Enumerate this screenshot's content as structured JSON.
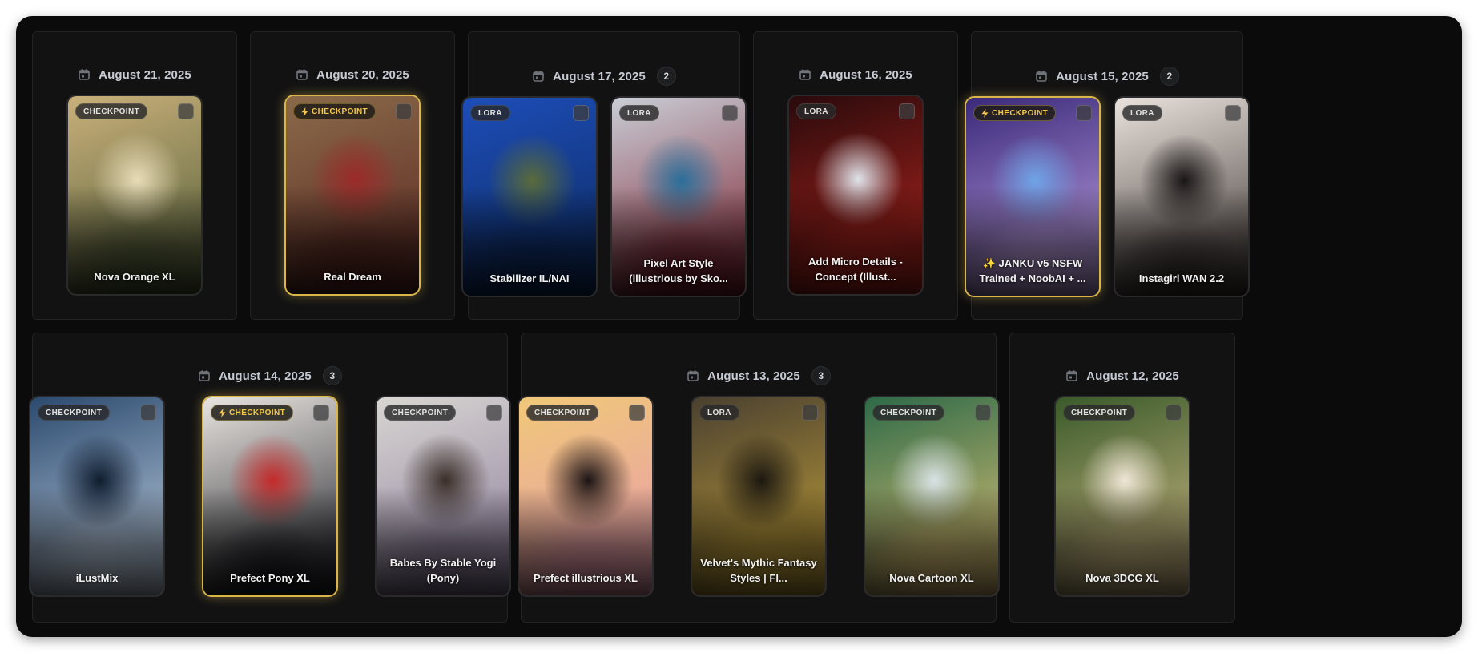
{
  "groups": [
    {
      "date": "August 21, 2025",
      "count": null,
      "cards": [
        {
          "badge": "CHECKPOINT",
          "featured": false,
          "title": "Nova Orange XL",
          "colors": [
            "#c9b07a",
            "#4d5a36",
            "#e8dcb8"
          ]
        }
      ]
    },
    {
      "date": "August 20, 2025",
      "count": null,
      "cards": [
        {
          "badge": "CHECKPOINT",
          "featured": true,
          "title": "Real Dream",
          "colors": [
            "#8a6a4a",
            "#5a2620",
            "#9b2a2a"
          ]
        }
      ]
    },
    {
      "date": "August 17, 2025",
      "count": "2",
      "cards": [
        {
          "badge": "LORA",
          "featured": false,
          "title": "Stabilizer IL/NAI",
          "colors": [
            "#1d4db8",
            "#0c2a5e",
            "#5a6b3a"
          ]
        },
        {
          "badge": "LORA",
          "featured": false,
          "title": "Pixel Art Style (illustrious by Sko...",
          "colors": [
            "#c9cdd6",
            "#7a1c2a",
            "#2a6e9a"
          ]
        }
      ]
    },
    {
      "date": "August 16, 2025",
      "count": null,
      "cards": [
        {
          "badge": "LORA",
          "featured": false,
          "title": "Add Micro Details - Concept (Illust...",
          "colors": [
            "#2a0a0c",
            "#b8261e",
            "#dfe3ea"
          ]
        }
      ]
    },
    {
      "date": "August 15, 2025",
      "count": "2",
      "cards": [
        {
          "badge": "CHECKPOINT",
          "featured": true,
          "title": "✨ JANKU v5 NSFW Trained + NoobAI + ...",
          "colors": [
            "#3a2a7a",
            "#c7a7e8",
            "#6fa3e6"
          ]
        },
        {
          "badge": "LORA",
          "featured": false,
          "title": "Instagirl WAN 2.2",
          "colors": [
            "#e9e2dc",
            "#3a3230",
            "#1a1616"
          ]
        }
      ]
    },
    {
      "date": "August 14, 2025",
      "count": "3",
      "cards": [
        {
          "badge": "CHECKPOINT",
          "featured": false,
          "title": "iLustMix",
          "colors": [
            "#2b4a6e",
            "#c9d8ea",
            "#0f1c2e"
          ]
        },
        {
          "badge": "CHECKPOINT",
          "featured": true,
          "title": "Prefect Pony XL",
          "colors": [
            "#e8e4e0",
            "#1b1c22",
            "#c42a2a"
          ]
        },
        {
          "badge": "CHECKPOINT",
          "featured": false,
          "title": "Babes By Stable Yogi (Pony)",
          "colors": [
            "#d8d6d2",
            "#8a7a9a",
            "#3a2e28"
          ]
        }
      ]
    },
    {
      "date": "August 13, 2025",
      "count": "3",
      "cards": [
        {
          "badge": "CHECKPOINT",
          "featured": false,
          "title": "Prefect illustrious XL",
          "colors": [
            "#f0c878",
            "#e89ab0",
            "#1c1414"
          ]
        },
        {
          "badge": "LORA",
          "featured": false,
          "title": "Velvet's Mythic Fantasy Styles | Fl...",
          "colors": [
            "#4a4030",
            "#c9a63a",
            "#1c1810"
          ]
        },
        {
          "badge": "CHECKPOINT",
          "featured": false,
          "title": "Nova Cartoon XL",
          "colors": [
            "#2e6a48",
            "#e8c878",
            "#d8e2e6"
          ]
        }
      ]
    },
    {
      "date": "August 12, 2025",
      "count": null,
      "cards": [
        {
          "badge": "CHECKPOINT",
          "featured": false,
          "title": "Nova 3DCG XL",
          "colors": [
            "#3a5a2a",
            "#d8c08a",
            "#efe6d6"
          ]
        }
      ]
    }
  ]
}
